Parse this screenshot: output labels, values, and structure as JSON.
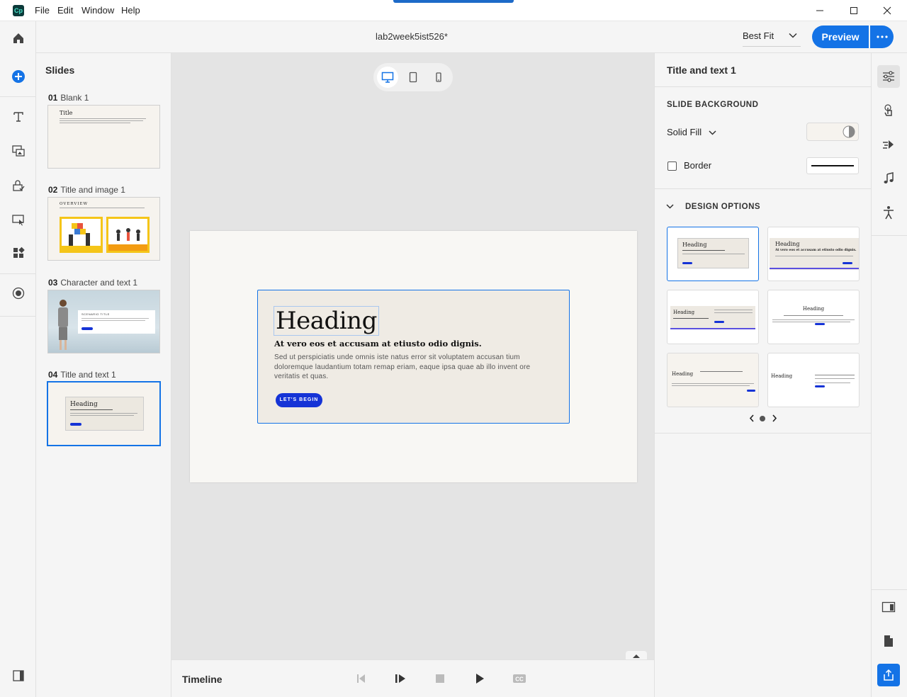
{
  "app": {
    "logo_text": "Cp",
    "menu": [
      "File",
      "Edit",
      "Window",
      "Help"
    ]
  },
  "header": {
    "doc_title": "lab2week5ist526*",
    "zoom": "Best Fit",
    "preview_label": "Preview"
  },
  "slides_panel": {
    "title": "Slides",
    "slides": [
      {
        "num": "01",
        "name": "Blank 1",
        "thumb_title": "Title"
      },
      {
        "num": "02",
        "name": "Title and image 1",
        "thumb_title": "OVERVIEW"
      },
      {
        "num": "03",
        "name": "Character and text 1",
        "thumb_title": "SCENARIO TITLE"
      },
      {
        "num": "04",
        "name": "Title and text 1",
        "thumb_title": "Heading"
      }
    ]
  },
  "slide": {
    "heading": "Heading",
    "subheading": "At vero eos et accusam at etiusto odio dignis.",
    "body": "Sed ut perspiciatis unde omnis iste natus error sit voluptatem accusan tium doloremque laudantium totam remap eriam, eaque ipsa quae ab illo invent ore veritatis et quas.",
    "cta": "LET'S BEGIN"
  },
  "timeline": {
    "label": "Timeline"
  },
  "properties": {
    "title": "Title and text 1",
    "slide_background": "SLIDE BACKGROUND",
    "fill_type": "Solid Fill",
    "fill_color": "#f6f3ee",
    "border_label": "Border",
    "border_checked": false,
    "design_options": "DESIGN OPTIONS",
    "design_heading": "Heading",
    "design_subheading": "At vero eos et accusam at etiusto odio dignis."
  },
  "colors": {
    "accent": "#1473e6",
    "cta": "#1533d6",
    "slide_bg": "#f8f7f4",
    "card_bg": "#efebe4"
  }
}
